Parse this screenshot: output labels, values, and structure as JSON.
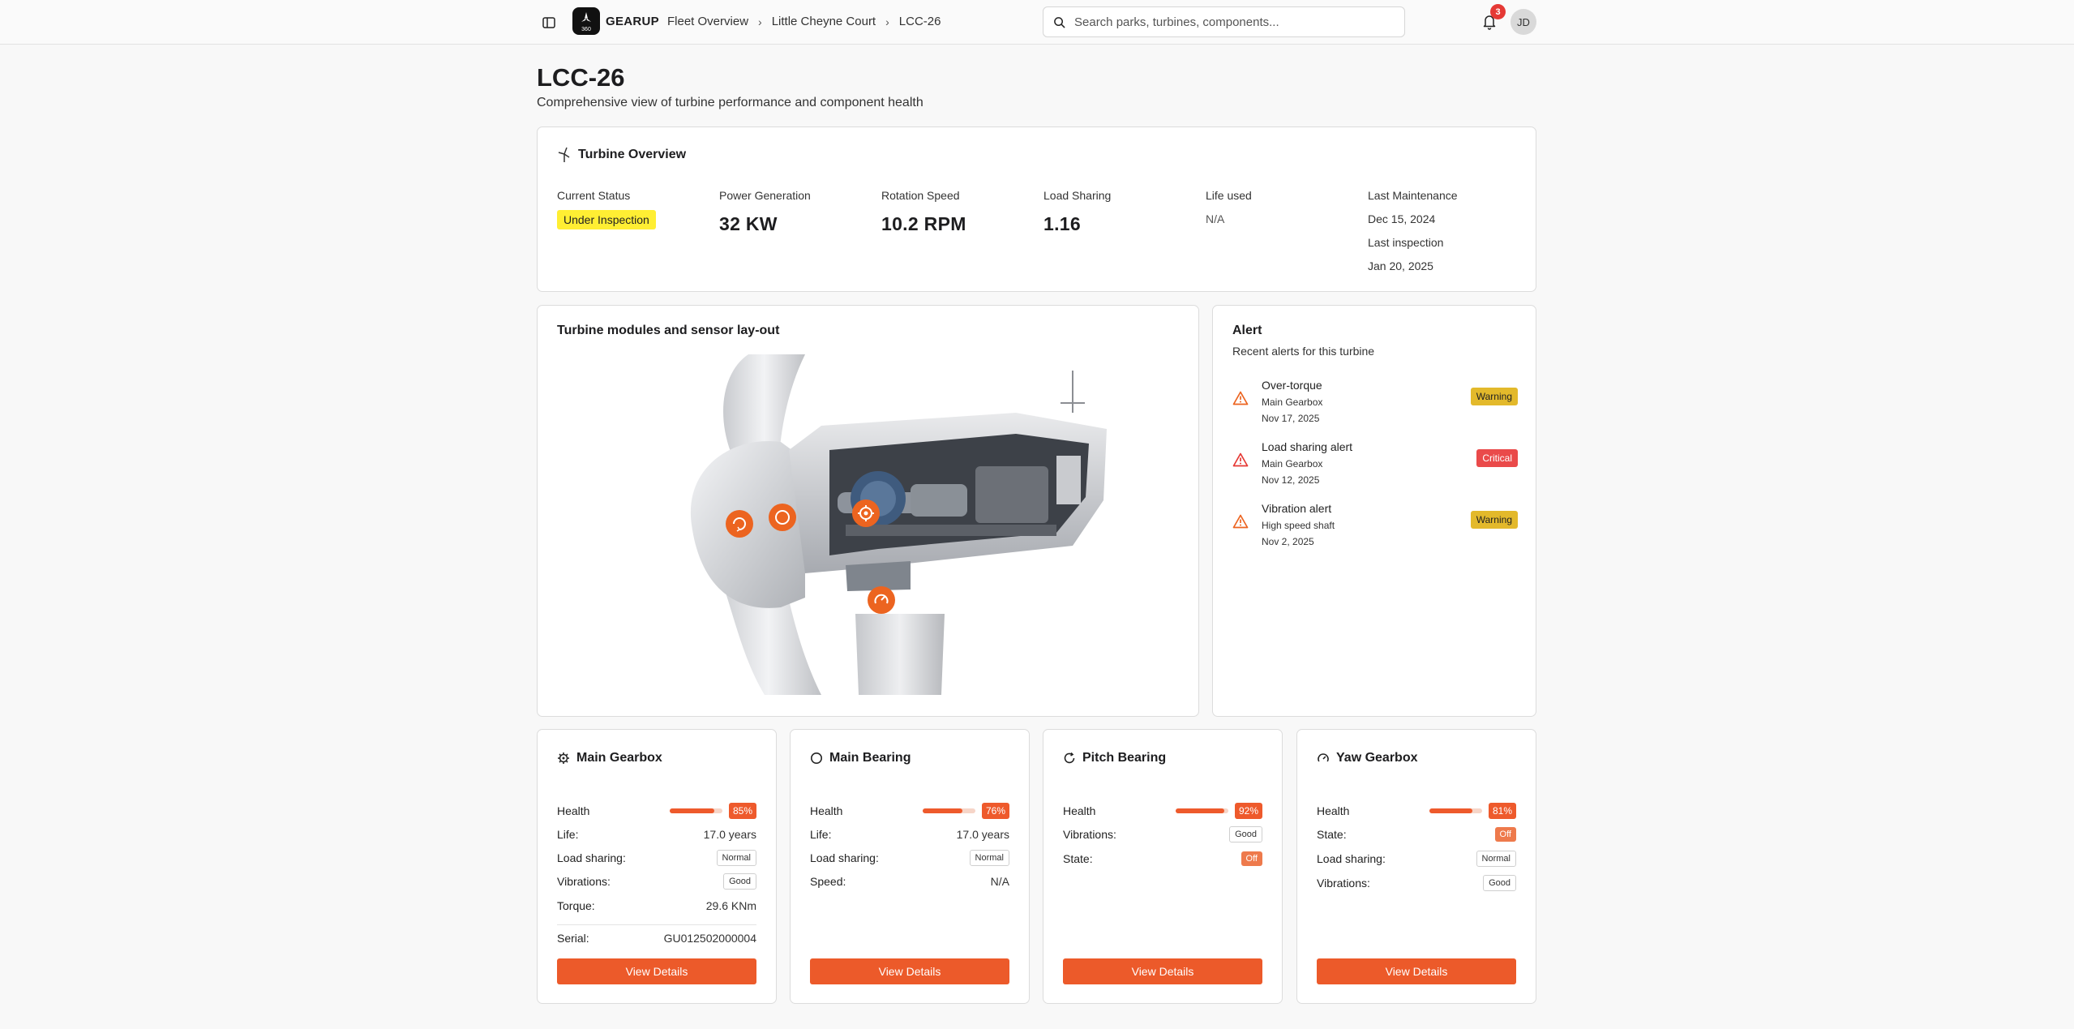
{
  "header": {
    "brand": "GEARUP",
    "logo_text": "360",
    "breadcrumbs": [
      "Fleet Overview",
      "Little Cheyne Court",
      "LCC-26"
    ],
    "search_placeholder": "Search parks, turbines, components...",
    "notification_count": "3",
    "user_initials": "JD"
  },
  "page": {
    "title": "LCC-26",
    "subtitle": "Comprehensive view of turbine performance and component health"
  },
  "overview": {
    "heading": "Turbine Overview",
    "status_label": "Current Status",
    "status_value": "Under Inspection",
    "power_label": "Power Generation",
    "power_value": "32 KW",
    "rotation_label": "Rotation Speed",
    "rotation_value": "10.2 RPM",
    "load_label": "Load Sharing",
    "load_value": "1.16",
    "life_label": "Life used",
    "life_value": "N/A",
    "maintenance_label": "Last Maintenance",
    "maintenance_value": "Dec 15, 2024",
    "inspection_label": "Last inspection",
    "inspection_value": "Jan 20, 2025"
  },
  "layout_card": {
    "title": "Turbine modules and sensor lay-out"
  },
  "alerts": {
    "title": "Alert",
    "subtitle": "Recent alerts for this turbine",
    "items": [
      {
        "title": "Over-torque",
        "component": "Main Gearbox",
        "date": "Nov 17, 2025",
        "severity": "Warning"
      },
      {
        "title": "Load sharing alert",
        "component": "Main Gearbox",
        "date": "Nov 12, 2025",
        "severity": "Critical"
      },
      {
        "title": "Vibration alert",
        "component": "High speed shaft",
        "date": "Nov 2, 2025",
        "severity": "Warning"
      }
    ]
  },
  "components": [
    {
      "name": "Main Gearbox",
      "icon": "gear-icon",
      "health": 85,
      "health_label": "85%",
      "rows": [
        {
          "label": "Life:",
          "value": "17.0 years",
          "kind": "text"
        },
        {
          "label": "Load sharing:",
          "value": "Normal",
          "kind": "tag"
        },
        {
          "label": "Vibrations:",
          "value": "Good",
          "kind": "tag"
        },
        {
          "label": "Torque:",
          "value": "29.6 KNm",
          "kind": "text"
        }
      ],
      "serial_label": "Serial:",
      "serial_value": "GU012502000004"
    },
    {
      "name": "Main Bearing",
      "icon": "circle-icon",
      "health": 76,
      "health_label": "76%",
      "rows": [
        {
          "label": "Life:",
          "value": "17.0 years",
          "kind": "text"
        },
        {
          "label": "Load sharing:",
          "value": "Normal",
          "kind": "tag"
        },
        {
          "label": "Speed:",
          "value": "N/A",
          "kind": "text"
        }
      ]
    },
    {
      "name": "Pitch Bearing",
      "icon": "rotate-icon",
      "health": 92,
      "health_label": "92%",
      "rows": [
        {
          "label": "Vibrations:",
          "value": "Good",
          "kind": "tag"
        },
        {
          "label": "State:",
          "value": "Off",
          "kind": "off"
        }
      ]
    },
    {
      "name": "Yaw Gearbox",
      "icon": "gauge-icon",
      "health": 81,
      "health_label": "81%",
      "rows": [
        {
          "label": "State:",
          "value": "Off",
          "kind": "off"
        },
        {
          "label": "Load sharing:",
          "value": "Normal",
          "kind": "tag"
        },
        {
          "label": "Vibrations:",
          "value": "Good",
          "kind": "tag"
        }
      ]
    }
  ],
  "labels": {
    "health": "Health",
    "view_details": "View Details"
  },
  "colors": {
    "accent": "#ec5a2a",
    "status_yellow": "#ffee33",
    "warning": "#e3b92b",
    "critical": "#ea4a4a"
  }
}
